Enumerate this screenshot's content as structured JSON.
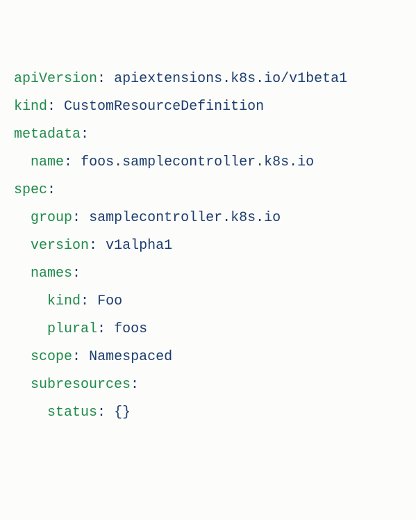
{
  "lines": [
    {
      "indent": 0,
      "key": "apiVersion",
      "value": "apiextensions.k8s.io/v1beta1"
    },
    {
      "indent": 0,
      "key": "kind",
      "value": "CustomResourceDefinition"
    },
    {
      "indent": 0,
      "key": "metadata",
      "value": ""
    },
    {
      "indent": 1,
      "key": "name",
      "value": "foos.samplecontroller.k8s.io"
    },
    {
      "indent": 0,
      "key": "spec",
      "value": ""
    },
    {
      "indent": 1,
      "key": "group",
      "value": "samplecontroller.k8s.io"
    },
    {
      "indent": 1,
      "key": "version",
      "value": "v1alpha1"
    },
    {
      "indent": 1,
      "key": "names",
      "value": ""
    },
    {
      "indent": 2,
      "key": "kind",
      "value": "Foo"
    },
    {
      "indent": 2,
      "key": "plural",
      "value": "foos"
    },
    {
      "indent": 1,
      "key": "scope",
      "value": "Namespaced"
    },
    {
      "indent": 1,
      "key": "subresources",
      "value": ""
    },
    {
      "indent": 2,
      "key": "status",
      "value": "{}"
    }
  ]
}
